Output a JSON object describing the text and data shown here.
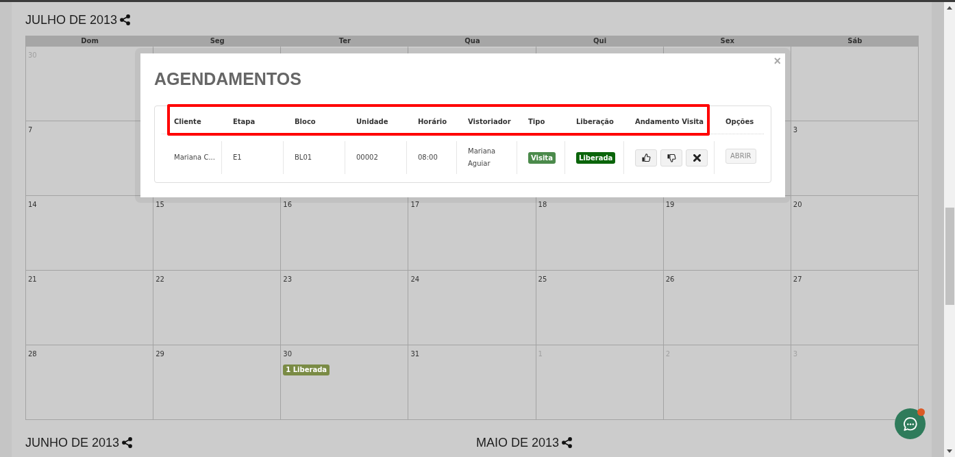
{
  "calendar": {
    "title": "JULHO DE 2013",
    "weekdays": [
      "Dom",
      "Seg",
      "Ter",
      "Qua",
      "Qui",
      "Sex",
      "Sáb"
    ],
    "weeks": [
      {
        "days": [
          {
            "day": "30",
            "other_month": true
          }
        ]
      },
      {
        "days": [
          {
            "day": "7",
            "other_month": false
          }
        ],
        "days_at_end": [
          {
            "day": "3",
            "other_month": false
          }
        ]
      },
      {
        "days": [
          {
            "day": "14",
            "other_month": false
          },
          {
            "day": "15",
            "other_month": false
          },
          {
            "day": "16",
            "other_month": false
          },
          {
            "day": "17",
            "other_month": false
          },
          {
            "day": "18",
            "other_month": false
          },
          {
            "day": "19",
            "other_month": false
          },
          {
            "day": "20",
            "other_month": false
          }
        ]
      },
      {
        "days": [
          {
            "day": "21",
            "other_month": false
          },
          {
            "day": "22",
            "other_month": false
          },
          {
            "day": "23",
            "other_month": false
          },
          {
            "day": "24",
            "other_month": false
          },
          {
            "day": "25",
            "other_month": false
          },
          {
            "day": "26",
            "other_month": false
          },
          {
            "day": "27",
            "other_month": false
          }
        ]
      },
      {
        "days": [
          {
            "day": "28",
            "other_month": false
          },
          {
            "day": "29",
            "other_month": false
          },
          {
            "day": "30",
            "other_month": false,
            "events": [
              {
                "label": "1 Liberada",
                "color": "#7a8b45"
              }
            ]
          },
          {
            "day": "31",
            "other_month": false
          },
          {
            "day": "1",
            "other_month": true
          },
          {
            "day": "2",
            "other_month": true
          },
          {
            "day": "3",
            "other_month": true
          }
        ]
      }
    ]
  },
  "more_months": [
    {
      "title": "JUNHO DE 2013"
    },
    {
      "title": "MAIO DE 2013"
    }
  ],
  "modal": {
    "title": "AGENDAMENTOS",
    "close": "×",
    "table": {
      "columns": [
        {
          "label": "Cliente",
          "highlighted": true
        },
        {
          "label": "Etapa",
          "highlighted": true
        },
        {
          "label": "Bloco",
          "highlighted": true
        },
        {
          "label": "Unidade",
          "highlighted": true
        },
        {
          "label": "Horário",
          "highlighted": true
        },
        {
          "label": "Vistoriador",
          "highlighted": true
        },
        {
          "label": "Tipo",
          "highlighted": true
        },
        {
          "label": "Liberação",
          "highlighted": true
        },
        {
          "label": "Andamento Visita",
          "highlighted": true
        },
        {
          "label": "Opções",
          "highlighted": false
        }
      ],
      "rows": [
        {
          "cells": [
            {
              "kind": "text",
              "text": "Mariana C..."
            },
            {
              "kind": "text",
              "text": "E1"
            },
            {
              "kind": "text",
              "text": "BL01"
            },
            {
              "kind": "text",
              "text": "00002"
            },
            {
              "kind": "text",
              "text": "08:00"
            },
            {
              "kind": "text",
              "text": "Mariana Aguiar"
            },
            {
              "kind": "badge",
              "text": "Visita",
              "color": "#4b8a4b"
            },
            {
              "kind": "badge",
              "text": "Liberada",
              "color": "#0a640a"
            },
            {
              "kind": "actions",
              "buttons": [
                {
                  "kind": "thumbs_up"
                },
                {
                  "kind": "thumbs_down"
                },
                {
                  "kind": "cancel"
                }
              ]
            },
            {
              "kind": "button",
              "text": "ABRIR"
            }
          ]
        }
      ]
    }
  },
  "chat_widget": {
    "notification": true
  }
}
